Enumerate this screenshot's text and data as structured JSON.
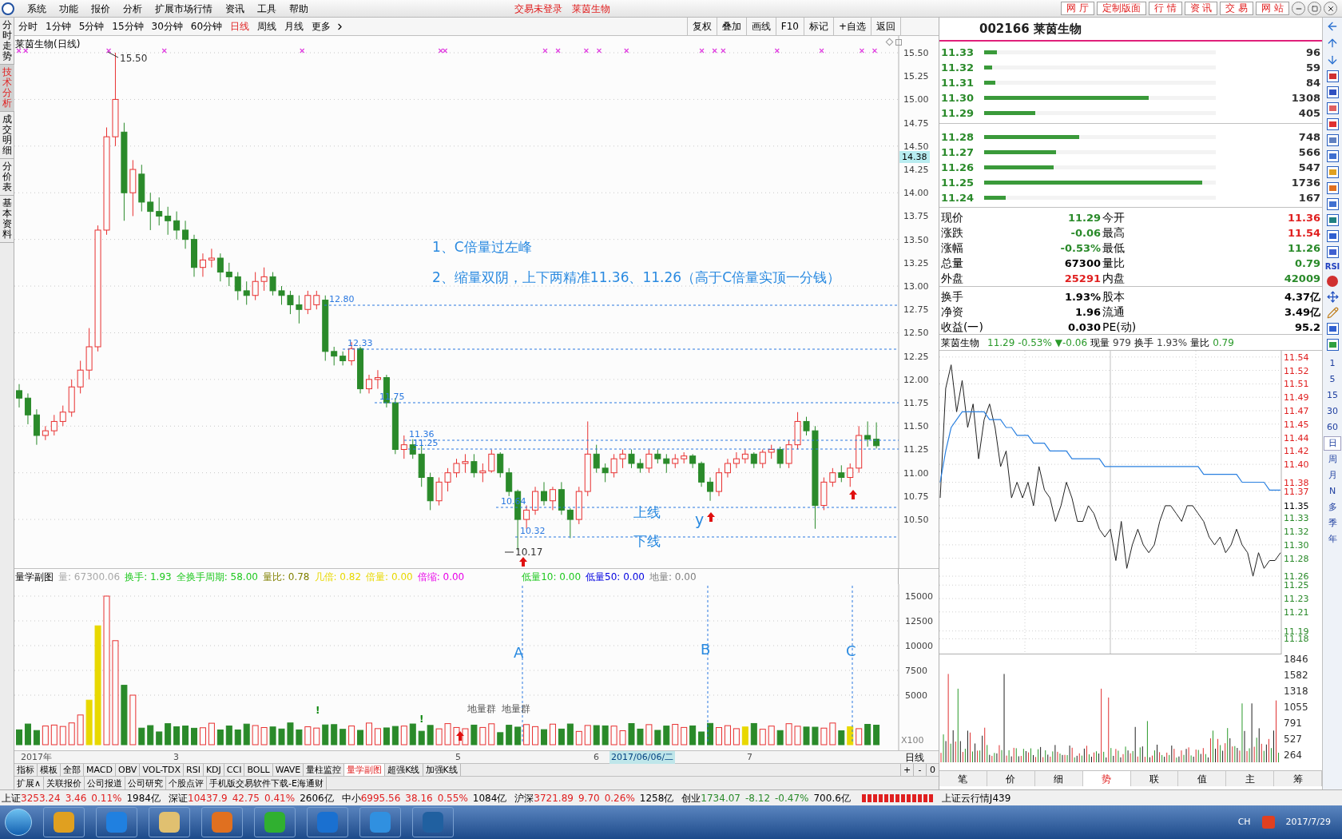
{
  "menu": {
    "items": [
      "系统",
      "功能",
      "报价",
      "分析",
      "扩展市场行情",
      "资讯",
      "工具",
      "帮助"
    ],
    "status": [
      "交易未登录",
      "莱茵生物"
    ],
    "buttons": [
      "网 厅",
      "定制版面",
      "行 情",
      "资 讯",
      "交 易",
      "网 站"
    ]
  },
  "period_tabs": [
    {
      "label": "分时",
      "selected": false
    },
    {
      "label": "1分钟",
      "selected": false
    },
    {
      "label": "5分钟",
      "selected": false
    },
    {
      "label": "15分钟",
      "selected": false
    },
    {
      "label": "30分钟",
      "selected": false
    },
    {
      "label": "60分钟",
      "selected": false
    },
    {
      "label": "日线",
      "selected": true
    },
    {
      "label": "周线",
      "selected": false
    },
    {
      "label": "月线",
      "selected": false
    },
    {
      "label": "更多",
      "selected": false
    }
  ],
  "tools": [
    "复权",
    "叠加",
    "画线",
    "F10",
    "标记",
    "+自选",
    "返回"
  ],
  "side_tabs": [
    {
      "label": "分时走势",
      "selected": false
    },
    {
      "label": "技术分析",
      "selected": true
    },
    {
      "label": "成交明细",
      "selected": false
    },
    {
      "label": "分价表",
      "selected": false
    },
    {
      "label": "基本资料",
      "selected": false
    }
  ],
  "chart": {
    "title": "莱茵生物(日线)",
    "high_label": "15.50",
    "low_label": "10.17",
    "current_price": "14.38",
    "chart_data": {
      "type": "candlestick",
      "ylim": [
        9.97,
        15.68
      ],
      "grid": true,
      "yticks": [
        {
          "value": 15.5,
          "label": "15.50"
        },
        {
          "value": 15.25,
          "label": "15.25"
        },
        {
          "value": 15,
          "label": "15.00"
        },
        {
          "value": 14.75,
          "label": "14.75"
        },
        {
          "value": 14.5,
          "label": "14.50"
        },
        {
          "value": 14.25,
          "label": "14.25"
        },
        {
          "value": 14,
          "label": "14.00"
        },
        {
          "value": 13.75,
          "label": "13.75"
        },
        {
          "value": 13.5,
          "label": "13.50"
        },
        {
          "value": 13.25,
          "label": "13.25"
        },
        {
          "value": 13,
          "label": "13.00"
        },
        {
          "value": 12.75,
          "label": "12.75"
        },
        {
          "value": 12.5,
          "label": "12.50"
        },
        {
          "value": 12.25,
          "label": "12.25"
        },
        {
          "value": 12,
          "label": "12.00"
        },
        {
          "value": 11.75,
          "label": "11.75"
        },
        {
          "value": 11.5,
          "label": "11.50"
        },
        {
          "value": 11.25,
          "label": "11.25"
        },
        {
          "value": 11,
          "label": "11.00"
        },
        {
          "value": 10.75,
          "label": "10.75"
        },
        {
          "value": 10.5,
          "label": "10.50"
        }
      ],
      "ohlc": [
        [
          11.88,
          11.95,
          11.7,
          11.8
        ],
        [
          11.8,
          11.85,
          11.52,
          11.62
        ],
        [
          11.62,
          11.68,
          11.3,
          11.4
        ],
        [
          11.4,
          11.5,
          11.35,
          11.45
        ],
        [
          11.45,
          11.62,
          11.4,
          11.55
        ],
        [
          11.55,
          11.72,
          11.5,
          11.65
        ],
        [
          11.65,
          12.0,
          11.6,
          11.92
        ],
        [
          11.92,
          12.2,
          11.85,
          12.1
        ],
        [
          12.1,
          12.55,
          12.0,
          12.35
        ],
        [
          12.35,
          13.65,
          12.3,
          13.6
        ],
        [
          13.6,
          14.7,
          13.55,
          14.6
        ],
        [
          14.6,
          15.5,
          14.5,
          15.0
        ],
        [
          14.65,
          14.75,
          13.7,
          14.0
        ],
        [
          14.0,
          14.35,
          13.75,
          14.25
        ],
        [
          14.2,
          14.3,
          13.8,
          13.9
        ],
        [
          13.9,
          14.0,
          13.6,
          13.8
        ],
        [
          13.8,
          13.95,
          13.65,
          13.75
        ],
        [
          13.75,
          13.85,
          13.55,
          13.7
        ],
        [
          13.7,
          13.8,
          13.5,
          13.6
        ],
        [
          13.6,
          13.7,
          13.4,
          13.5
        ],
        [
          13.5,
          13.55,
          13.1,
          13.2
        ],
        [
          13.2,
          13.35,
          13.1,
          13.28
        ],
        [
          13.28,
          13.4,
          13.2,
          13.3
        ],
        [
          13.3,
          13.35,
          13.05,
          13.15
        ],
        [
          13.15,
          13.25,
          13.0,
          13.1
        ],
        [
          13.1,
          13.15,
          12.85,
          12.95
        ],
        [
          12.95,
          13.05,
          12.8,
          12.9
        ],
        [
          12.9,
          13.15,
          12.85,
          13.05
        ],
        [
          13.05,
          13.2,
          12.95,
          13.1
        ],
        [
          13.1,
          13.15,
          12.9,
          12.95
        ],
        [
          12.95,
          13.0,
          12.8,
          12.9
        ],
        [
          12.9,
          12.95,
          12.7,
          12.8
        ],
        [
          12.8,
          12.9,
          12.6,
          12.75
        ],
        [
          12.75,
          12.95,
          12.7,
          12.9
        ],
        [
          12.8,
          12.95,
          12.75,
          12.9
        ],
        [
          12.85,
          12.9,
          12.2,
          12.3
        ],
        [
          12.3,
          12.35,
          12.15,
          12.25
        ],
        [
          12.25,
          12.3,
          12.15,
          12.2
        ],
        [
          12.2,
          12.4,
          12.15,
          12.33
        ],
        [
          12.33,
          12.35,
          11.85,
          11.9
        ],
        [
          11.9,
          12.05,
          11.85,
          12.0
        ],
        [
          12.0,
          12.1,
          11.9,
          12.02
        ],
        [
          12.02,
          12.05,
          11.7,
          11.75
        ],
        [
          11.75,
          11.8,
          11.2,
          11.25
        ],
        [
          11.25,
          11.4,
          11.15,
          11.3
        ],
        [
          11.3,
          11.36,
          11.15,
          11.2
        ],
        [
          11.2,
          11.3,
          10.85,
          10.95
        ],
        [
          10.95,
          11.0,
          10.6,
          10.7
        ],
        [
          10.7,
          10.95,
          10.65,
          10.9
        ],
        [
          10.9,
          11.05,
          10.8,
          11.0
        ],
        [
          11.0,
          11.15,
          10.95,
          11.1
        ],
        [
          11.1,
          11.2,
          11.0,
          11.12
        ],
        [
          11.12,
          11.2,
          10.95,
          11.0
        ],
        [
          11.0,
          11.1,
          10.9,
          11.02
        ],
        [
          11.02,
          11.25,
          11.0,
          11.2
        ],
        [
          11.2,
          11.22,
          10.95,
          11.0
        ],
        [
          11.0,
          11.05,
          10.75,
          10.8
        ],
        [
          10.8,
          10.82,
          10.17,
          10.5
        ],
        [
          10.5,
          10.65,
          10.4,
          10.6
        ],
        [
          10.6,
          10.85,
          10.55,
          10.8
        ],
        [
          10.8,
          10.9,
          10.65,
          10.7
        ],
        [
          10.7,
          10.85,
          10.6,
          10.82
        ],
        [
          10.82,
          10.9,
          10.55,
          10.6
        ],
        [
          10.6,
          10.62,
          10.3,
          10.5
        ],
        [
          10.5,
          10.85,
          10.45,
          10.8
        ],
        [
          10.8,
          11.55,
          10.75,
          11.2
        ],
        [
          11.2,
          11.3,
          11.0,
          11.05
        ],
        [
          11.05,
          11.1,
          10.9,
          11.0
        ],
        [
          11.0,
          11.2,
          10.95,
          11.15
        ],
        [
          11.15,
          11.25,
          11.05,
          11.2
        ],
        [
          11.2,
          11.25,
          11.05,
          11.1
        ],
        [
          11.1,
          11.15,
          11.0,
          11.05
        ],
        [
          11.05,
          11.25,
          11.0,
          11.2
        ],
        [
          11.2,
          11.25,
          11.1,
          11.15
        ],
        [
          11.15,
          11.2,
          11.0,
          11.1
        ],
        [
          11.1,
          11.2,
          11.05,
          11.15
        ],
        [
          11.15,
          11.22,
          11.1,
          11.18
        ],
        [
          11.18,
          11.2,
          11.05,
          11.1
        ],
        [
          11.1,
          11.12,
          10.85,
          10.9
        ],
        [
          10.9,
          10.95,
          10.7,
          10.8
        ],
        [
          10.8,
          11.05,
          10.75,
          11.0
        ],
        [
          11.0,
          11.15,
          10.95,
          11.1
        ],
        [
          11.1,
          11.22,
          11.05,
          11.15
        ],
        [
          11.15,
          11.25,
          11.1,
          11.2
        ],
        [
          11.2,
          11.22,
          11.05,
          11.1
        ],
        [
          11.1,
          11.25,
          11.05,
          11.22
        ],
        [
          11.22,
          11.3,
          11.15,
          11.25
        ],
        [
          11.25,
          11.28,
          11.05,
          11.1
        ],
        [
          11.1,
          11.35,
          11.05,
          11.3
        ],
        [
          11.3,
          11.65,
          11.25,
          11.55
        ],
        [
          11.55,
          11.6,
          11.4,
          11.45
        ],
        [
          11.45,
          11.5,
          10.4,
          10.65
        ],
        [
          10.65,
          10.95,
          10.6,
          10.9
        ],
        [
          10.9,
          11.05,
          10.85,
          11.0
        ],
        [
          11.0,
          11.08,
          10.9,
          10.95
        ],
        [
          10.95,
          11.1,
          10.85,
          11.05
        ],
        [
          11.05,
          11.5,
          11.0,
          11.4
        ],
        [
          11.4,
          11.55,
          11.28,
          11.36
        ],
        [
          11.36,
          11.54,
          11.26,
          11.29
        ]
      ]
    },
    "notes": [
      "1、C倍量过左峰",
      "2、缩量双阴，上下两精准11.36、11.26（高于C倍量实顶一分钱）"
    ],
    "levels": [
      {
        "label": "12.80"
      },
      {
        "label": "12.33"
      },
      {
        "label": "11.75"
      },
      {
        "label": "11.36"
      },
      {
        "label": "11.25"
      },
      {
        "label": "10.64"
      },
      {
        "label": "10.32"
      }
    ],
    "line_labels": [
      "上线",
      "下线"
    ],
    "mark": "y"
  },
  "volume": {
    "title": "量学副图",
    "readouts": [
      {
        "text": "量: 67300.06",
        "color": "#a8a8a8"
      },
      {
        "text": "换手: 1.93",
        "color": "#1fc81f"
      },
      {
        "text": "全换手周期: 58.00",
        "color": "#1fc81f"
      },
      {
        "text": "量比: 0.78",
        "color": "#808000"
      },
      {
        "text": "几倍: 0.82",
        "color": "#e8d800"
      },
      {
        "text": "倍量: 0.00",
        "color": "#e8d800"
      },
      {
        "text": "倍缩: 0.00",
        "color": "#e800e8"
      },
      {
        "text": "低量10: 0.00",
        "color": "#1fc81f"
      },
      {
        "text": "低量50: 0.00",
        "color": "#0000e0"
      },
      {
        "text": "地量: 0.00",
        "color": "#808080"
      }
    ],
    "yticks": [
      "15000",
      "12500",
      "10000",
      "7500",
      "5000"
    ],
    "unit": "X100",
    "markers": [
      "A",
      "B",
      "C"
    ],
    "group_labels": [
      "地量群",
      "地量群"
    ],
    "alerts": [
      "!",
      "!"
    ]
  },
  "dates": [
    {
      "label": "2017年",
      "selected": false
    },
    {
      "label": "3",
      "selected": false
    },
    {
      "label": "5",
      "selected": false
    },
    {
      "label": "6",
      "selected": false
    },
    {
      "label": "2017/06/06/二",
      "selected": true
    },
    {
      "label": "7",
      "selected": false
    }
  ],
  "period_label": "日线",
  "indicator_tabs": [
    {
      "label": "指标",
      "selected": false
    },
    {
      "label": "模板",
      "selected": false
    },
    {
      "label": "全部",
      "selected": false
    },
    {
      "label": "MACD",
      "selected": false
    },
    {
      "label": "OBV",
      "selected": false
    },
    {
      "label": "VOL-TDX",
      "selected": false
    },
    {
      "label": "RSI",
      "selected": false
    },
    {
      "label": "KDJ",
      "selected": false
    },
    {
      "label": "CCI",
      "selected": false
    },
    {
      "label": "BOLL",
      "selected": false
    },
    {
      "label": "WAVE",
      "selected": false
    },
    {
      "label": "量柱监控",
      "selected": false
    },
    {
      "label": "量学副图",
      "selected": true
    },
    {
      "label": "超强K线",
      "selected": false
    },
    {
      "label": "加强K线",
      "selected": false
    }
  ],
  "zoom_buttons": [
    "+",
    "-",
    "0"
  ],
  "extend_tabs": [
    "扩展∧",
    "关联报价",
    "公司报道",
    "公司研究",
    "个股点评",
    "手机版交易软件下载-E海通财"
  ],
  "quote": {
    "title": "002166 莱茵生物",
    "asks": [
      {
        "price": "11.33",
        "volume": "96",
        "level": 0.055
      },
      {
        "price": "11.32",
        "volume": "59",
        "level": 0.034
      },
      {
        "price": "11.31",
        "volume": "84",
        "level": 0.048
      },
      {
        "price": "11.30",
        "volume": "1308",
        "level": 0.71
      },
      {
        "price": "11.29",
        "volume": "405",
        "level": 0.22
      }
    ],
    "bids": [
      {
        "price": "11.28",
        "volume": "748",
        "level": 0.41
      },
      {
        "price": "11.27",
        "volume": "566",
        "level": 0.31
      },
      {
        "price": "11.26",
        "volume": "547",
        "level": 0.3
      },
      {
        "price": "11.25",
        "volume": "1736",
        "level": 0.94
      },
      {
        "price": "11.24",
        "volume": "167",
        "level": 0.093
      }
    ],
    "stats": [
      [
        {
          "label": "现价",
          "value": "11.29",
          "kind": "down"
        },
        {
          "label": "今开",
          "value": "11.36",
          "kind": "up"
        },
        {
          "label": "涨跌",
          "value": "-0.06",
          "kind": "down"
        },
        {
          "label": "最高",
          "value": "11.54",
          "kind": "up"
        },
        {
          "label": "涨幅",
          "value": "-0.53%",
          "kind": "down"
        },
        {
          "label": "最低",
          "value": "11.26",
          "kind": "down"
        },
        {
          "label": "总量",
          "value": "67300",
          "kind": "flat"
        },
        {
          "label": "量比",
          "value": "0.79",
          "kind": "down"
        },
        {
          "label": "外盘",
          "value": "25291",
          "kind": "up"
        },
        {
          "label": "内盘",
          "value": "42009",
          "kind": "down"
        }
      ],
      [
        {
          "label": "换手",
          "value": "1.93%",
          "kind": "flat"
        },
        {
          "label": "股本",
          "value": "4.37亿",
          "kind": "flat"
        },
        {
          "label": "净资",
          "value": "1.96",
          "kind": "flat"
        },
        {
          "label": "流通",
          "value": "3.49亿",
          "kind": "flat"
        },
        {
          "label": "收益(一)",
          "value": "0.030",
          "kind": "flat"
        },
        {
          "label": "PE(动)",
          "value": "95.2",
          "kind": "flat"
        }
      ]
    ]
  },
  "intraday": {
    "name": "莱茵生物",
    "readouts": [
      {
        "text": "11.29",
        "color": "#2a9a2a"
      },
      {
        "text": "-0.53%",
        "color": "#2a9a2a"
      },
      {
        "text": "▼-0.06",
        "color": "#2a9a2a"
      },
      {
        "text": "现量"
      },
      {
        "text": "979",
        "color": "#404040"
      },
      {
        "text": "换手"
      },
      {
        "text": "1.93%",
        "color": "#404040"
      },
      {
        "text": "量比"
      },
      {
        "text": "0.79",
        "color": "#2a9a2a"
      }
    ],
    "chart_data": {
      "type": "line",
      "ylim": [
        11.16,
        11.548
      ],
      "grid": true,
      "yticks": [
        {
          "value": 11.54,
          "label": "11.54"
        },
        {
          "value": 11.5229,
          "label": "11.52"
        },
        {
          "value": 11.5057,
          "label": "11.51"
        },
        {
          "value": 11.4886,
          "label": "11.49"
        },
        {
          "value": 11.4714,
          "label": "11.47"
        },
        {
          "value": 11.4543,
          "label": "11.45"
        },
        {
          "value": 11.4371,
          "label": "11.44"
        },
        {
          "value": 11.42,
          "label": "11.42"
        },
        {
          "value": 11.4029,
          "label": "11.40"
        },
        {
          "value": 11.38,
          "label": "11.38"
        },
        {
          "value": 11.3686,
          "label": "11.37"
        },
        {
          "value": 11.35,
          "label": "11.35"
        },
        {
          "value": 11.3343,
          "label": "11.33"
        },
        {
          "value": 11.3171,
          "label": "11.32"
        },
        {
          "value": 11.3,
          "label": "11.30"
        },
        {
          "value": 11.2829,
          "label": "11.28"
        },
        {
          "value": 11.26,
          "label": "11.26"
        },
        {
          "value": 11.2486,
          "label": "11.25"
        },
        {
          "value": 11.2314,
          "label": "11.23"
        },
        {
          "value": 11.2143,
          "label": "11.21"
        },
        {
          "value": 11.19,
          "label": "11.19"
        },
        {
          "value": 11.18,
          "label": "11.18"
        }
      ],
      "series": [
        {
          "color": "#202020",
          "values": [
            11.36,
            11.5,
            11.53,
            11.47,
            11.51,
            11.45,
            11.48,
            11.41,
            11.46,
            11.48,
            11.45,
            11.4,
            11.42,
            11.36,
            11.38,
            11.36,
            11.38,
            11.35,
            11.4,
            11.37,
            11.36,
            11.33,
            11.35,
            11.38,
            11.36,
            11.33,
            11.33,
            11.35,
            11.34,
            11.32,
            11.31,
            11.32,
            11.28,
            11.33,
            11.27,
            11.3,
            11.32,
            11.3,
            11.29,
            11.3,
            11.33,
            11.35,
            11.35,
            11.34,
            11.33,
            11.35,
            11.35,
            11.34,
            11.33,
            11.31,
            11.3,
            11.31,
            11.29,
            11.3,
            11.32,
            11.3,
            11.29,
            11.26,
            11.29,
            11.27,
            11.28,
            11.28,
            11.29
          ]
        },
        {
          "color": "#2a80e0",
          "values": [
            11.38,
            11.42,
            11.45,
            11.46,
            11.47,
            11.47,
            11.47,
            11.47,
            11.47,
            11.46,
            11.46,
            11.46,
            11.45,
            11.45,
            11.44,
            11.44,
            11.44,
            11.43,
            11.43,
            11.43,
            11.42,
            11.42,
            11.42,
            11.42,
            11.41,
            11.41,
            11.41,
            11.41,
            11.41,
            11.41,
            11.4,
            11.4,
            11.4,
            11.4,
            11.4,
            11.4,
            11.4,
            11.4,
            11.4,
            11.4,
            11.4,
            11.4,
            11.4,
            11.4,
            11.4,
            11.4,
            11.4,
            11.4,
            11.39,
            11.39,
            11.39,
            11.39,
            11.39,
            11.39,
            11.39,
            11.38,
            11.38,
            11.38,
            11.38,
            11.38,
            11.37,
            11.37,
            11.37
          ]
        }
      ]
    },
    "tick_styles": [
      {
        "color": "#e02020"
      },
      {
        "color": "#e02020"
      },
      {
        "color": "#e02020"
      },
      {
        "color": "#e02020"
      },
      {
        "color": "#e02020"
      },
      {
        "color": "#e02020"
      },
      {
        "color": "#e02020"
      },
      {
        "color": "#e02020"
      },
      {
        "color": "#e02020"
      },
      {
        "color": "#e02020"
      },
      {
        "color": "#e02020"
      },
      {
        "color": "#000000"
      },
      {
        "color": "#2a8a2a"
      },
      {
        "color": "#2a8a2a"
      },
      {
        "color": "#2a8a2a"
      },
      {
        "color": "#2a8a2a"
      },
      {
        "color": "#2a8a2a"
      },
      {
        "color": "#2a8a2a"
      },
      {
        "color": "#2a8a2a"
      },
      {
        "color": "#2a8a2a"
      },
      {
        "color": "#2a8a2a"
      },
      {
        "color": "#2a8a2a"
      }
    ],
    "volume_ticks": [
      "1846",
      "1582",
      "1318",
      "1055",
      "791",
      "527",
      "264"
    ],
    "tabs": [
      {
        "label": "笔",
        "selected": false
      },
      {
        "label": "价",
        "selected": false
      },
      {
        "label": "细",
        "selected": false
      },
      {
        "label": "势",
        "selected": true
      },
      {
        "label": "联",
        "selected": false
      },
      {
        "label": "值",
        "selected": false
      },
      {
        "label": "主",
        "selected": false
      },
      {
        "label": "筹",
        "selected": false
      }
    ]
  },
  "side_tools": {
    "text_icon": "RSI",
    "periods": [
      {
        "label": "1",
        "selected": false
      },
      {
        "label": "5",
        "selected": false
      },
      {
        "label": "15",
        "selected": false
      },
      {
        "label": "30",
        "selected": false
      },
      {
        "label": "60",
        "selected": false
      },
      {
        "label": "日",
        "selected": true
      },
      {
        "label": "周",
        "selected": false
      },
      {
        "label": "月",
        "selected": false
      },
      {
        "label": "N",
        "selected": false
      },
      {
        "label": "多",
        "selected": false
      },
      {
        "label": "季",
        "selected": false
      },
      {
        "label": "年",
        "selected": false
      }
    ]
  },
  "status_bar": {
    "indices": [
      {
        "name": "上证",
        "value": "3253.24",
        "change": "3.46",
        "pct": "0.11%",
        "amount": "1984亿",
        "kind": "up"
      },
      {
        "name": "深证",
        "value": "10437.9",
        "change": "42.75",
        "pct": "0.41%",
        "amount": "2606亿",
        "kind": "up"
      },
      {
        "name": "中小",
        "value": "6995.56",
        "change": "38.16",
        "pct": "0.55%",
        "amount": "1084亿",
        "kind": "up"
      },
      {
        "name": "沪深",
        "value": "3721.89",
        "change": "9.70",
        "pct": "0.26%",
        "amount": "1258亿",
        "kind": "up"
      },
      {
        "name": "创业",
        "value": "1734.07",
        "change": "-8.12",
        "pct": "-0.47%",
        "amount": "700.6亿",
        "kind": "down"
      }
    ],
    "cloud": "上证云行情J439"
  },
  "taskbar": {
    "lang": "CH",
    "date": "2017/7/29"
  }
}
